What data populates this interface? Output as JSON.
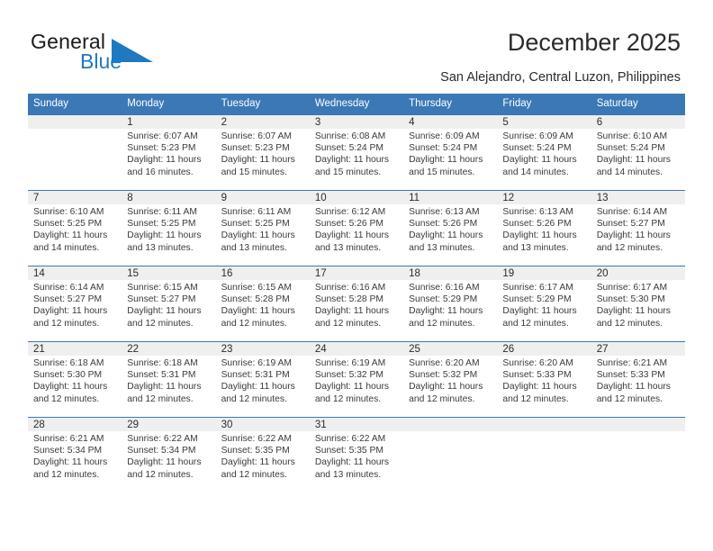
{
  "logo": {
    "word1": "General",
    "word2": "Blue",
    "triangle_color": "#1f79c0",
    "icon": "triangle-logo-icon"
  },
  "header": {
    "title": "December 2025",
    "subtitle": "San Alejandro, Central Luzon, Philippines"
  },
  "theme": {
    "header_blue": "#3b78b5",
    "daynum_gray": "#efefef",
    "text": "#333333"
  },
  "calendar": {
    "weekdays": [
      "Sunday",
      "Monday",
      "Tuesday",
      "Wednesday",
      "Thursday",
      "Friday",
      "Saturday"
    ],
    "weeks": [
      [
        {
          "day": "",
          "sunrise": "",
          "sunset": "",
          "daylight": ""
        },
        {
          "day": "1",
          "sunrise": "Sunrise: 6:07 AM",
          "sunset": "Sunset: 5:23 PM",
          "daylight": "Daylight: 11 hours and 16 minutes."
        },
        {
          "day": "2",
          "sunrise": "Sunrise: 6:07 AM",
          "sunset": "Sunset: 5:23 PM",
          "daylight": "Daylight: 11 hours and 15 minutes."
        },
        {
          "day": "3",
          "sunrise": "Sunrise: 6:08 AM",
          "sunset": "Sunset: 5:24 PM",
          "daylight": "Daylight: 11 hours and 15 minutes."
        },
        {
          "day": "4",
          "sunrise": "Sunrise: 6:09 AM",
          "sunset": "Sunset: 5:24 PM",
          "daylight": "Daylight: 11 hours and 15 minutes."
        },
        {
          "day": "5",
          "sunrise": "Sunrise: 6:09 AM",
          "sunset": "Sunset: 5:24 PM",
          "daylight": "Daylight: 11 hours and 14 minutes."
        },
        {
          "day": "6",
          "sunrise": "Sunrise: 6:10 AM",
          "sunset": "Sunset: 5:24 PM",
          "daylight": "Daylight: 11 hours and 14 minutes."
        }
      ],
      [
        {
          "day": "7",
          "sunrise": "Sunrise: 6:10 AM",
          "sunset": "Sunset: 5:25 PM",
          "daylight": "Daylight: 11 hours and 14 minutes."
        },
        {
          "day": "8",
          "sunrise": "Sunrise: 6:11 AM",
          "sunset": "Sunset: 5:25 PM",
          "daylight": "Daylight: 11 hours and 13 minutes."
        },
        {
          "day": "9",
          "sunrise": "Sunrise: 6:11 AM",
          "sunset": "Sunset: 5:25 PM",
          "daylight": "Daylight: 11 hours and 13 minutes."
        },
        {
          "day": "10",
          "sunrise": "Sunrise: 6:12 AM",
          "sunset": "Sunset: 5:26 PM",
          "daylight": "Daylight: 11 hours and 13 minutes."
        },
        {
          "day": "11",
          "sunrise": "Sunrise: 6:13 AM",
          "sunset": "Sunset: 5:26 PM",
          "daylight": "Daylight: 11 hours and 13 minutes."
        },
        {
          "day": "12",
          "sunrise": "Sunrise: 6:13 AM",
          "sunset": "Sunset: 5:26 PM",
          "daylight": "Daylight: 11 hours and 13 minutes."
        },
        {
          "day": "13",
          "sunrise": "Sunrise: 6:14 AM",
          "sunset": "Sunset: 5:27 PM",
          "daylight": "Daylight: 11 hours and 12 minutes."
        }
      ],
      [
        {
          "day": "14",
          "sunrise": "Sunrise: 6:14 AM",
          "sunset": "Sunset: 5:27 PM",
          "daylight": "Daylight: 11 hours and 12 minutes."
        },
        {
          "day": "15",
          "sunrise": "Sunrise: 6:15 AM",
          "sunset": "Sunset: 5:27 PM",
          "daylight": "Daylight: 11 hours and 12 minutes."
        },
        {
          "day": "16",
          "sunrise": "Sunrise: 6:15 AM",
          "sunset": "Sunset: 5:28 PM",
          "daylight": "Daylight: 11 hours and 12 minutes."
        },
        {
          "day": "17",
          "sunrise": "Sunrise: 6:16 AM",
          "sunset": "Sunset: 5:28 PM",
          "daylight": "Daylight: 11 hours and 12 minutes."
        },
        {
          "day": "18",
          "sunrise": "Sunrise: 6:16 AM",
          "sunset": "Sunset: 5:29 PM",
          "daylight": "Daylight: 11 hours and 12 minutes."
        },
        {
          "day": "19",
          "sunrise": "Sunrise: 6:17 AM",
          "sunset": "Sunset: 5:29 PM",
          "daylight": "Daylight: 11 hours and 12 minutes."
        },
        {
          "day": "20",
          "sunrise": "Sunrise: 6:17 AM",
          "sunset": "Sunset: 5:30 PM",
          "daylight": "Daylight: 11 hours and 12 minutes."
        }
      ],
      [
        {
          "day": "21",
          "sunrise": "Sunrise: 6:18 AM",
          "sunset": "Sunset: 5:30 PM",
          "daylight": "Daylight: 11 hours and 12 minutes."
        },
        {
          "day": "22",
          "sunrise": "Sunrise: 6:18 AM",
          "sunset": "Sunset: 5:31 PM",
          "daylight": "Daylight: 11 hours and 12 minutes."
        },
        {
          "day": "23",
          "sunrise": "Sunrise: 6:19 AM",
          "sunset": "Sunset: 5:31 PM",
          "daylight": "Daylight: 11 hours and 12 minutes."
        },
        {
          "day": "24",
          "sunrise": "Sunrise: 6:19 AM",
          "sunset": "Sunset: 5:32 PM",
          "daylight": "Daylight: 11 hours and 12 minutes."
        },
        {
          "day": "25",
          "sunrise": "Sunrise: 6:20 AM",
          "sunset": "Sunset: 5:32 PM",
          "daylight": "Daylight: 11 hours and 12 minutes."
        },
        {
          "day": "26",
          "sunrise": "Sunrise: 6:20 AM",
          "sunset": "Sunset: 5:33 PM",
          "daylight": "Daylight: 11 hours and 12 minutes."
        },
        {
          "day": "27",
          "sunrise": "Sunrise: 6:21 AM",
          "sunset": "Sunset: 5:33 PM",
          "daylight": "Daylight: 11 hours and 12 minutes."
        }
      ],
      [
        {
          "day": "28",
          "sunrise": "Sunrise: 6:21 AM",
          "sunset": "Sunset: 5:34 PM",
          "daylight": "Daylight: 11 hours and 12 minutes."
        },
        {
          "day": "29",
          "sunrise": "Sunrise: 6:22 AM",
          "sunset": "Sunset: 5:34 PM",
          "daylight": "Daylight: 11 hours and 12 minutes."
        },
        {
          "day": "30",
          "sunrise": "Sunrise: 6:22 AM",
          "sunset": "Sunset: 5:35 PM",
          "daylight": "Daylight: 11 hours and 12 minutes."
        },
        {
          "day": "31",
          "sunrise": "Sunrise: 6:22 AM",
          "sunset": "Sunset: 5:35 PM",
          "daylight": "Daylight: 11 hours and 13 minutes."
        },
        {
          "day": "",
          "sunrise": "",
          "sunset": "",
          "daylight": ""
        },
        {
          "day": "",
          "sunrise": "",
          "sunset": "",
          "daylight": ""
        },
        {
          "day": "",
          "sunrise": "",
          "sunset": "",
          "daylight": ""
        }
      ]
    ]
  }
}
